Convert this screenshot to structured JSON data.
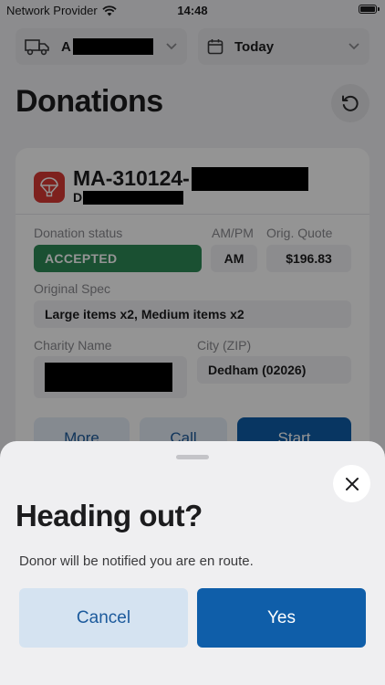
{
  "status_bar": {
    "carrier": "Network Provider",
    "time": "14:48"
  },
  "header": {
    "truck_selector": {
      "value_visible": "A"
    },
    "date_selector": {
      "value": "Today"
    },
    "title": "Donations"
  },
  "card": {
    "job_id_prefix": "MA-310124-",
    "donor_initial": "D",
    "donation_status_label": "Donation status",
    "donation_status_value": "ACCEPTED",
    "ampm_label": "AM/PM",
    "ampm_value": "AM",
    "orig_quote_label": "Orig. Quote",
    "orig_quote_value": "$196.83",
    "original_spec_label": "Original Spec",
    "original_spec_value": "Large items x2, Medium items x2",
    "charity_name_label": "Charity Name",
    "city_zip_label": "City (ZIP)",
    "city_zip_value": "Dedham (02026)",
    "buttons": {
      "more": "More",
      "call": "Call",
      "start": "Start"
    }
  },
  "sheet": {
    "title": "Heading out?",
    "message": "Donor will be notified you are en route.",
    "cancel_label": "Cancel",
    "yes_label": "Yes"
  },
  "colors": {
    "status_green": "#2e8b57",
    "primary_blue": "#0f5ea9",
    "cancel_bg": "#d5e3f1",
    "job_icon_red": "#d93a35"
  },
  "icons": [
    "wifi-icon",
    "battery-icon",
    "truck-icon",
    "calendar-icon",
    "chevron-down-icon",
    "refresh-icon",
    "donation-parachute-icon",
    "close-icon"
  ]
}
